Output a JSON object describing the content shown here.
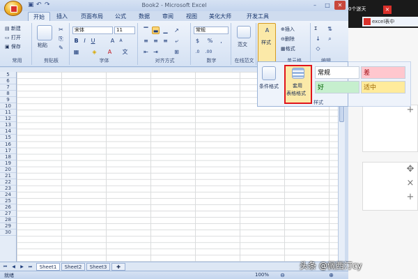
{
  "window": {
    "title": "Book2 - Microsoft Excel"
  },
  "ribbon_tabs": [
    "开始",
    "插入",
    "页面布局",
    "公式",
    "数据",
    "审阅",
    "视图",
    "美化大师",
    "开发工具"
  ],
  "clipboard": {
    "new": "新建",
    "open": "打开",
    "save": "保存",
    "group_label": "常用",
    "paste": "粘贴",
    "clipboard_label": "剪贴板"
  },
  "font": {
    "name": "宋体",
    "size": "11",
    "group_label": "字体"
  },
  "alignment": {
    "group_label": "对齐方式"
  },
  "number": {
    "format": "常规",
    "percent": "%",
    "group_label": "数字"
  },
  "online": {
    "label": "范文",
    "group_label": "在线范文"
  },
  "styles": {
    "label": "样式",
    "gallery_label": "样式"
  },
  "cells": {
    "insert": "插入",
    "delete": "删除",
    "format": "格式",
    "group_label": "单元格"
  },
  "editing": {
    "sum": "Σ",
    "group_label": "编辑"
  },
  "gallery": {
    "conditional": "条件格式",
    "format_table": [
      "套用",
      "表格格式"
    ],
    "cell_styles": [
      {
        "text": "常规",
        "bg": "#ffffff",
        "color": "#000000"
      },
      {
        "text": "差",
        "bg": "#ffc7ce",
        "color": "#9c0006"
      },
      {
        "text": "好",
        "bg": "#c6efce",
        "color": "#006100"
      },
      {
        "text": "适中",
        "bg": "#ffeb9c",
        "color": "#9c6500"
      }
    ]
  },
  "rows": [
    "5",
    "6",
    "7",
    "8",
    "9",
    "10",
    "11",
    "12",
    "13",
    "14",
    "15",
    "16",
    "17",
    "18",
    "19",
    "20",
    "21",
    "22",
    "23",
    "24",
    "25",
    "26",
    "27",
    "28",
    "29",
    "30"
  ],
  "sheet_tabs": [
    "Sheet1",
    "Sheet2",
    "Sheet3"
  ],
  "status": {
    "ready": "就绪",
    "zoom": "100%"
  },
  "browser": {
    "tab_a": "0个迷天",
    "tab_b": "excel表中"
  },
  "watermark": "头条 @佩西汀cy",
  "highlight_color": "#e0141b"
}
